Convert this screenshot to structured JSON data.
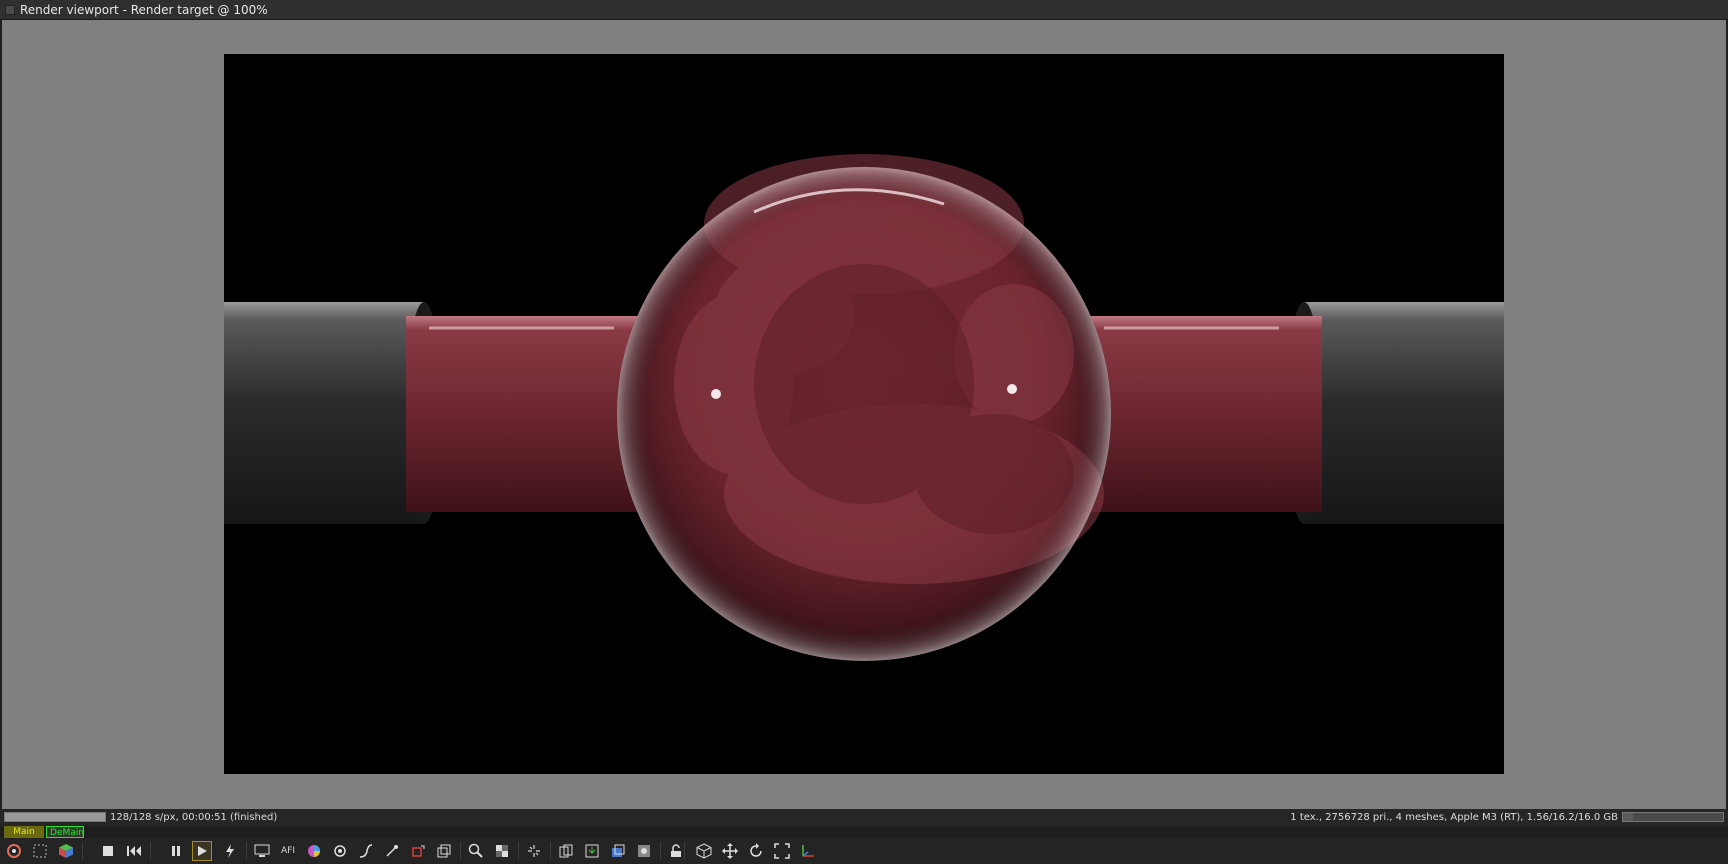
{
  "window": {
    "title": "Render viewport - Render target @ 100%"
  },
  "status": {
    "progress": 1.0,
    "left_text": "128/128 s/px, 00:00:51 (finished)",
    "right_text": "1 tex., 2756728 pri., 4 meshes, Apple M3 (RT), 1.56/16.2/16.0 GB",
    "memory_fraction": 0.1
  },
  "tabs": [
    {
      "label": "Main",
      "color": "#e5e514"
    },
    {
      "label": "DeMain",
      "color": "#2ee02e"
    }
  ],
  "toolbar": {
    "icons": [
      "render-settings-icon",
      "region-icon",
      "color-cube-icon",
      "stop-icon",
      "restart-icon",
      "pause-icon",
      "start-icon",
      "flash-icon",
      "display-icon",
      "afi-icon",
      "color-wheel-icon",
      "camera-response-icon",
      "curve-icon",
      "picker-icon",
      "red-square-icon",
      "layer-icon",
      "zoom-icon",
      "checker-icon",
      "spark-icon",
      "copy-icon",
      "save-icon",
      "export-icon",
      "import-icon",
      "lock-icon",
      "cube-icon",
      "move-icon",
      "rotate-icon",
      "fullscreen-icon",
      "axis-icon"
    ]
  },
  "colors": {
    "viewport_bg": "#808080",
    "toolbar_bg": "#242424",
    "active_border": "#a58a2a"
  }
}
